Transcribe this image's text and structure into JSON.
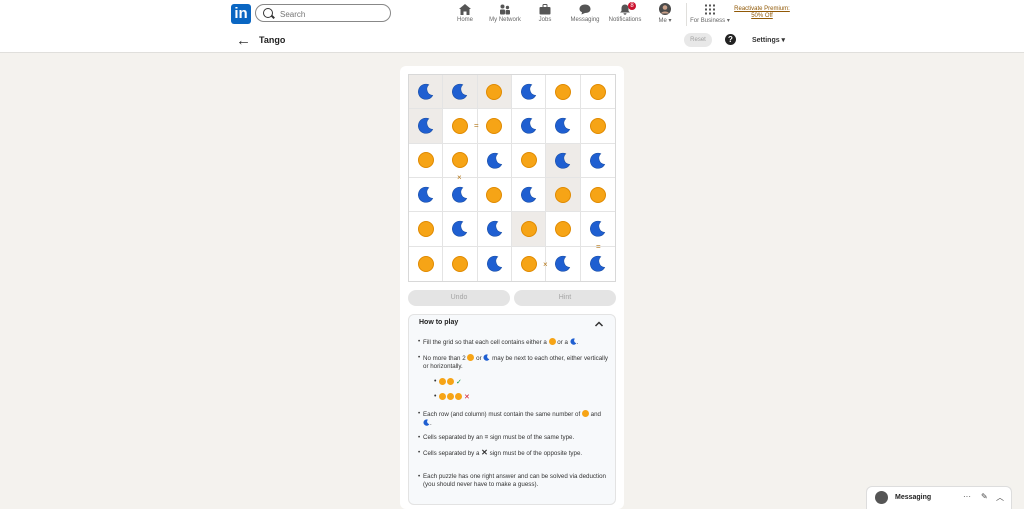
{
  "topbar": {
    "logo": "in",
    "search_placeholder": "Search",
    "nav": [
      {
        "label": "Home",
        "icon": "home-icon"
      },
      {
        "label": "My Network",
        "icon": "network-icon"
      },
      {
        "label": "Jobs",
        "icon": "briefcase-icon"
      },
      {
        "label": "Messaging",
        "icon": "chat-icon"
      },
      {
        "label": "Notifications",
        "icon": "bell-icon",
        "badge": "8"
      },
      {
        "label": "Me ▾",
        "icon": "avatar"
      },
      {
        "label": "For Business ▾",
        "icon": "apps-grid-icon"
      }
    ],
    "premium_line1": "Reactivate Premium:",
    "premium_line2": "50% Off"
  },
  "subbar": {
    "back_icon": "←",
    "title": "Tango",
    "reset": "Reset",
    "help": "?",
    "settings": "Settings ▾"
  },
  "board": {
    "cells": [
      [
        "moon",
        "moon",
        "sun",
        "moon",
        "sun",
        "sun"
      ],
      [
        "moon",
        "sun",
        "sun",
        "moon",
        "moon",
        "sun"
      ],
      [
        "sun",
        "sun",
        "moon",
        "sun",
        "moon",
        "moon"
      ],
      [
        "moon",
        "moon",
        "sun",
        "moon",
        "sun",
        "sun"
      ],
      [
        "sun",
        "moon",
        "moon",
        "sun",
        "sun",
        "moon"
      ],
      [
        "sun",
        "sun",
        "moon",
        "sun",
        "moon",
        "moon"
      ]
    ],
    "locked": [
      [
        0,
        0
      ],
      [
        0,
        1
      ],
      [
        0,
        2
      ],
      [
        1,
        0
      ],
      [
        2,
        4
      ],
      [
        3,
        4
      ],
      [
        4,
        3
      ]
    ],
    "equal_sign": "=",
    "cross_sign": "×"
  },
  "buttons": {
    "undo": "Undo",
    "hint": "Hint"
  },
  "howto": {
    "title": "How to play",
    "rule1_a": "Fill the grid so that each cell contains either a",
    "rule1_b": "or a",
    "rule2_a": "No more than 2",
    "rule2_b": "or",
    "rule2_c": "may be next to each other, either vertically or horizontally.",
    "example_ok": "✓",
    "example_bad": "✕",
    "rule3_a": "Each row (and column) must contain the same number of",
    "rule3_b": "and",
    "rule4_a": "Cells separated by an",
    "rule4_sign": "=",
    "rule4_b": "sign must be of the same type.",
    "rule5_a": "Cells separated by a",
    "rule5_sign": "✕",
    "rule5_b": "sign must be of the opposite type.",
    "rule6": "Each puzzle has one right answer and can be solved via deduction (you should never have to make a guess)."
  },
  "messaging": {
    "label": "Messaging",
    "more": "···",
    "compose": "✎",
    "collapse": "︿"
  },
  "colors": {
    "sun": "#f6a416",
    "moon": "#1f5fd1",
    "linkedin": "#0a66c2"
  }
}
